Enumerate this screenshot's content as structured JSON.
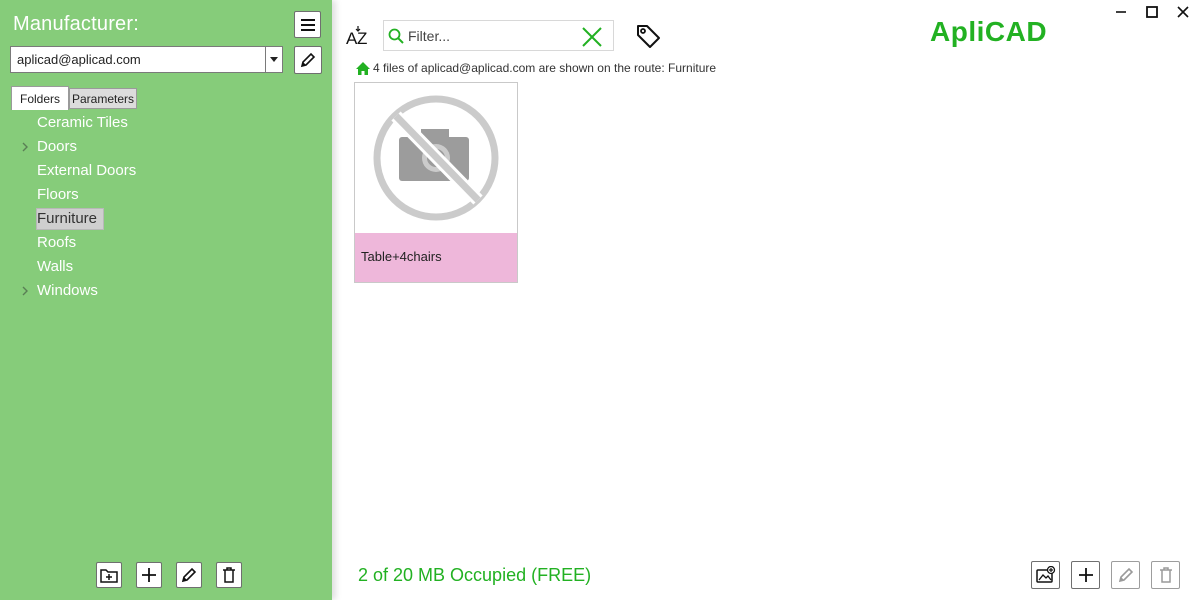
{
  "sidebar": {
    "title": "Manufacturer:",
    "account": {
      "value": "aplicad@aplicad.com"
    },
    "tabs": [
      {
        "label": "Folders",
        "active": true
      },
      {
        "label": "Parameters",
        "active": false
      }
    ],
    "folders": [
      {
        "label": "Ceramic Tiles",
        "expandable": false,
        "selected": false
      },
      {
        "label": "Doors",
        "expandable": true,
        "selected": false
      },
      {
        "label": "External Doors",
        "expandable": false,
        "selected": false
      },
      {
        "label": "Floors",
        "expandable": false,
        "selected": false
      },
      {
        "label": "Furniture",
        "expandable": false,
        "selected": true
      },
      {
        "label": "Roofs",
        "expandable": false,
        "selected": false
      },
      {
        "label": "Walls",
        "expandable": false,
        "selected": false
      },
      {
        "label": "Windows",
        "expandable": true,
        "selected": false
      }
    ],
    "bottom_buttons": [
      "new-folder-icon",
      "plus-icon",
      "pencil-icon",
      "trash-icon"
    ]
  },
  "toolbar": {
    "sort_icon": "sort-az-icon",
    "filter": {
      "placeholder": "Filter...",
      "value": ""
    },
    "tag_icon": "tag-icon"
  },
  "brand": {
    "name": "ApliCAD",
    "color": "#22b122"
  },
  "route": {
    "text": "4 files of aplicad@aplicad.com are shown on the route: Furniture"
  },
  "files": [
    {
      "name": "Table+4chairs",
      "thumbnail": "no-image-icon",
      "label_color": "#eeb7da"
    }
  ],
  "status": {
    "storage": "2 of 20 MB Occupied (FREE)"
  },
  "colors": {
    "sidebar": "#86cc7a",
    "accent": "#22b122"
  }
}
